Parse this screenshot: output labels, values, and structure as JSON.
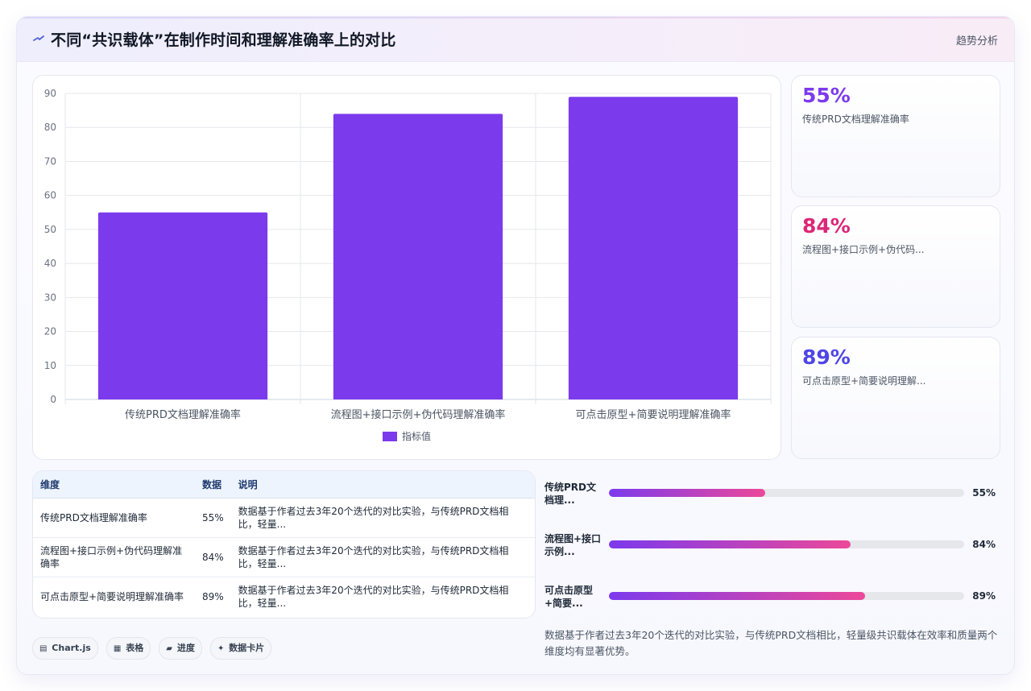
{
  "header": {
    "title": "不同“共识载体”在制作时间和理解准确率上的对比",
    "right_link": "趋势分析"
  },
  "chart_data": {
    "type": "bar",
    "categories": [
      "传统PRD文档理解准确率",
      "流程图+接口示例+伪代码理解准确率",
      "可点击原型+简要说明理解准确率"
    ],
    "series": [
      {
        "name": "指标值",
        "values": [
          55,
          84,
          89
        ],
        "color": "#7c3aed"
      }
    ],
    "ylim": [
      0,
      90
    ],
    "yticks": [
      0,
      10,
      20,
      30,
      40,
      50,
      60,
      70,
      80,
      90
    ],
    "grid": true,
    "legend": "bottom"
  },
  "stats": [
    {
      "value": "55%",
      "label": "传统PRD文档理解准确率",
      "color": "#7c3aed"
    },
    {
      "value": "84%",
      "label": "流程图+接口示例+伪代码...",
      "color": "#db2777"
    },
    {
      "value": "89%",
      "label": "可点击原型+简要说明理解...",
      "color": "#4f46e5"
    }
  ],
  "table": {
    "headers": [
      "维度",
      "数据",
      "说明"
    ],
    "rows": [
      {
        "dim": "传统PRD文档理解准确率",
        "val": "55%",
        "desc": "数据基于作者过去3年20个迭代的对比实验，与传统PRD文档相比，轻量..."
      },
      {
        "dim": "流程图+接口示例+伪代码理解准确率",
        "val": "84%",
        "desc": "数据基于作者过去3年20个迭代的对比实验，与传统PRD文档相比，轻量..."
      },
      {
        "dim": "可点击原型+简要说明理解准确率",
        "val": "89%",
        "desc": "数据基于作者过去3年20个迭代的对比实验，与传统PRD文档相比，轻量..."
      }
    ]
  },
  "progress": [
    {
      "label": "传统PRD文档理...",
      "value": "55%",
      "fraction": 0.44
    },
    {
      "label": "流程图+接口示例...",
      "value": "84%",
      "fraction": 0.68
    },
    {
      "label": "可点击原型+简要...",
      "value": "89%",
      "fraction": 0.72
    }
  ],
  "summary": "数据基于作者过去3年20个迭代的对比实验，与传统PRD文档相比，轻量级共识载体在效率和质量两个维度均有显著优势。",
  "chips": [
    {
      "icon": "chart-icon",
      "glyph": "▤",
      "label": "Chart.js"
    },
    {
      "icon": "table-icon",
      "glyph": "▦",
      "label": "表格"
    },
    {
      "icon": "progress-icon",
      "glyph": "▰",
      "label": "进度"
    },
    {
      "icon": "sparkle-icon",
      "glyph": "✦",
      "label": "数据卡片"
    }
  ]
}
